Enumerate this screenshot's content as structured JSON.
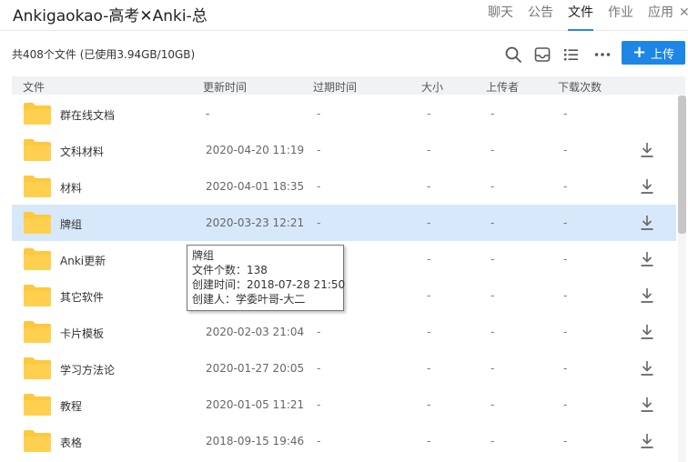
{
  "window": {
    "title": "Ankigaokao-高考✕Anki-总"
  },
  "nav": {
    "tabs": [
      {
        "label": "聊天"
      },
      {
        "label": "公告"
      },
      {
        "label": "文件",
        "active": true
      },
      {
        "label": "作业"
      },
      {
        "label": "应用"
      }
    ],
    "close_glyph": "✕"
  },
  "toolbar": {
    "summary": "共408个文件 (已使用3.94GB/10GB)",
    "icons": [
      "search-icon",
      "inbox-icon",
      "list-view-icon",
      "more-icon"
    ],
    "upload_plus": "+",
    "upload_label": "上传"
  },
  "colors": {
    "accent": "#1e86e5",
    "selected_row": "#d6e8fa",
    "header_bg": "#f0f2f5",
    "folder": "#ffc83d"
  },
  "table": {
    "columns": {
      "name": "文件",
      "updated": "更新时间",
      "expires": "过期时间",
      "size": "大小",
      "uploader": "上传者",
      "downloads": "下载次数"
    },
    "rows": [
      {
        "name": "群在线文档",
        "updated": "-",
        "expires": "-",
        "size": "-",
        "uploader": "-",
        "downloads": "-",
        "downloadable": false
      },
      {
        "name": "文科材料",
        "updated": "2020-04-20 11:19",
        "expires": "-",
        "size": "-",
        "uploader": "-",
        "downloads": "-",
        "downloadable": true
      },
      {
        "name": "材料",
        "updated": "2020-04-01 18:35",
        "expires": "-",
        "size": "-",
        "uploader": "-",
        "downloads": "-",
        "downloadable": true
      },
      {
        "name": "牌组",
        "updated": "2020-03-23 12:21",
        "expires": "-",
        "size": "-",
        "uploader": "-",
        "downloads": "-",
        "downloadable": true,
        "selected": true
      },
      {
        "name": "Anki更新",
        "updated": "",
        "expires": "-",
        "size": "-",
        "uploader": "-",
        "downloads": "-",
        "downloadable": true
      },
      {
        "name": "其它软件",
        "updated": "",
        "expires": "-",
        "size": "-",
        "uploader": "-",
        "downloads": "-",
        "downloadable": true
      },
      {
        "name": "卡片模板",
        "updated": "2020-02-03 21:04",
        "expires": "-",
        "size": "-",
        "uploader": "-",
        "downloads": "-",
        "downloadable": true
      },
      {
        "name": "学习方法论",
        "updated": "2020-01-27 20:05",
        "expires": "-",
        "size": "-",
        "uploader": "-",
        "downloads": "-",
        "downloadable": true
      },
      {
        "name": "教程",
        "updated": "2020-01-05 11:21",
        "expires": "-",
        "size": "-",
        "uploader": "-",
        "downloads": "-",
        "downloadable": true
      },
      {
        "name": "表格",
        "updated": "2018-09-15 19:46",
        "expires": "-",
        "size": "-",
        "uploader": "-",
        "downloads": "-",
        "downloadable": true
      }
    ]
  },
  "tooltip": {
    "name": "牌组",
    "file_count": "文件个数：138",
    "created_time": "创建时间：2018-07-28 21:50",
    "creator": "创建人：学委叶哥-大二"
  }
}
